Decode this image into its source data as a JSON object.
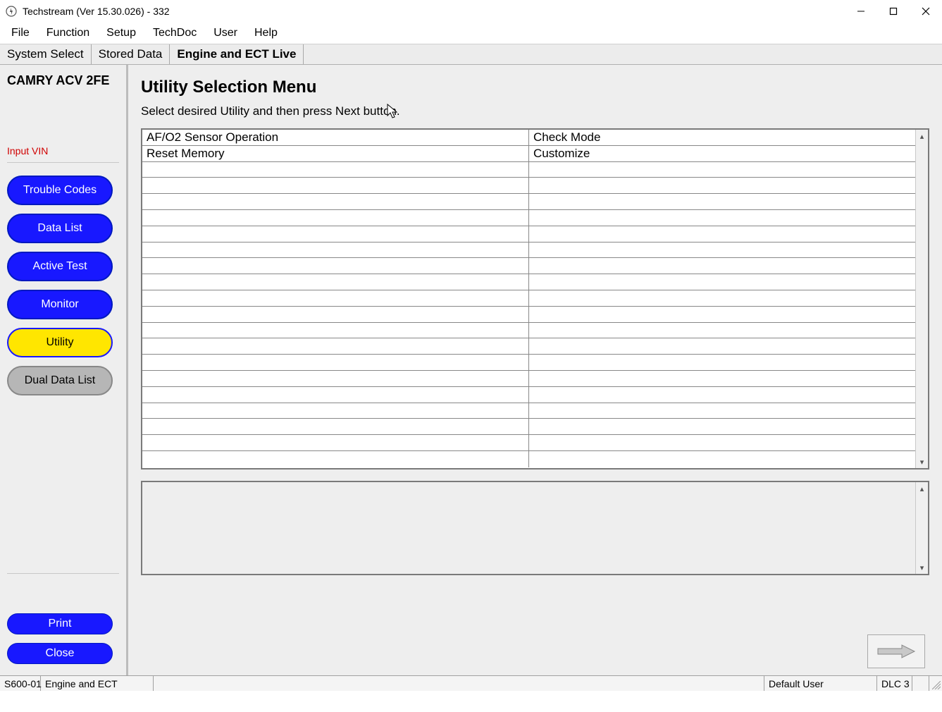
{
  "window": {
    "title": "Techstream (Ver 15.30.026) - 332"
  },
  "menu": {
    "items": [
      "File",
      "Function",
      "Setup",
      "TechDoc",
      "User",
      "Help"
    ]
  },
  "tabs": {
    "items": [
      {
        "label": "System Select",
        "active": false
      },
      {
        "label": "Stored Data",
        "active": false
      },
      {
        "label": "Engine and ECT Live",
        "active": true
      }
    ]
  },
  "sidebar": {
    "vehicle": "CAMRY ACV 2FE",
    "input_vin": "Input VIN",
    "buttons": {
      "trouble_codes": "Trouble Codes",
      "data_list": "Data List",
      "active_test": "Active Test",
      "monitor": "Monitor",
      "utility": "Utility",
      "dual_data_list": "Dual Data List",
      "print": "Print",
      "close": "Close"
    }
  },
  "main": {
    "heading": "Utility Selection Menu",
    "instruction": "Select desired Utility and then press Next button.",
    "table_rows": [
      [
        "AF/O2 Sensor Operation",
        "Check Mode"
      ],
      [
        "Reset Memory",
        "Customize"
      ],
      [
        "",
        ""
      ],
      [
        "",
        ""
      ],
      [
        "",
        ""
      ],
      [
        "",
        ""
      ],
      [
        "",
        ""
      ],
      [
        "",
        ""
      ],
      [
        "",
        ""
      ],
      [
        "",
        ""
      ],
      [
        "",
        ""
      ],
      [
        "",
        ""
      ],
      [
        "",
        ""
      ],
      [
        "",
        ""
      ],
      [
        "",
        ""
      ],
      [
        "",
        ""
      ],
      [
        "",
        ""
      ],
      [
        "",
        ""
      ],
      [
        "",
        ""
      ],
      [
        "",
        ""
      ],
      [
        "",
        ""
      ]
    ]
  },
  "statusbar": {
    "code": "S600-01",
    "system": "Engine and ECT",
    "user": "Default User",
    "dlc": "DLC 3"
  }
}
